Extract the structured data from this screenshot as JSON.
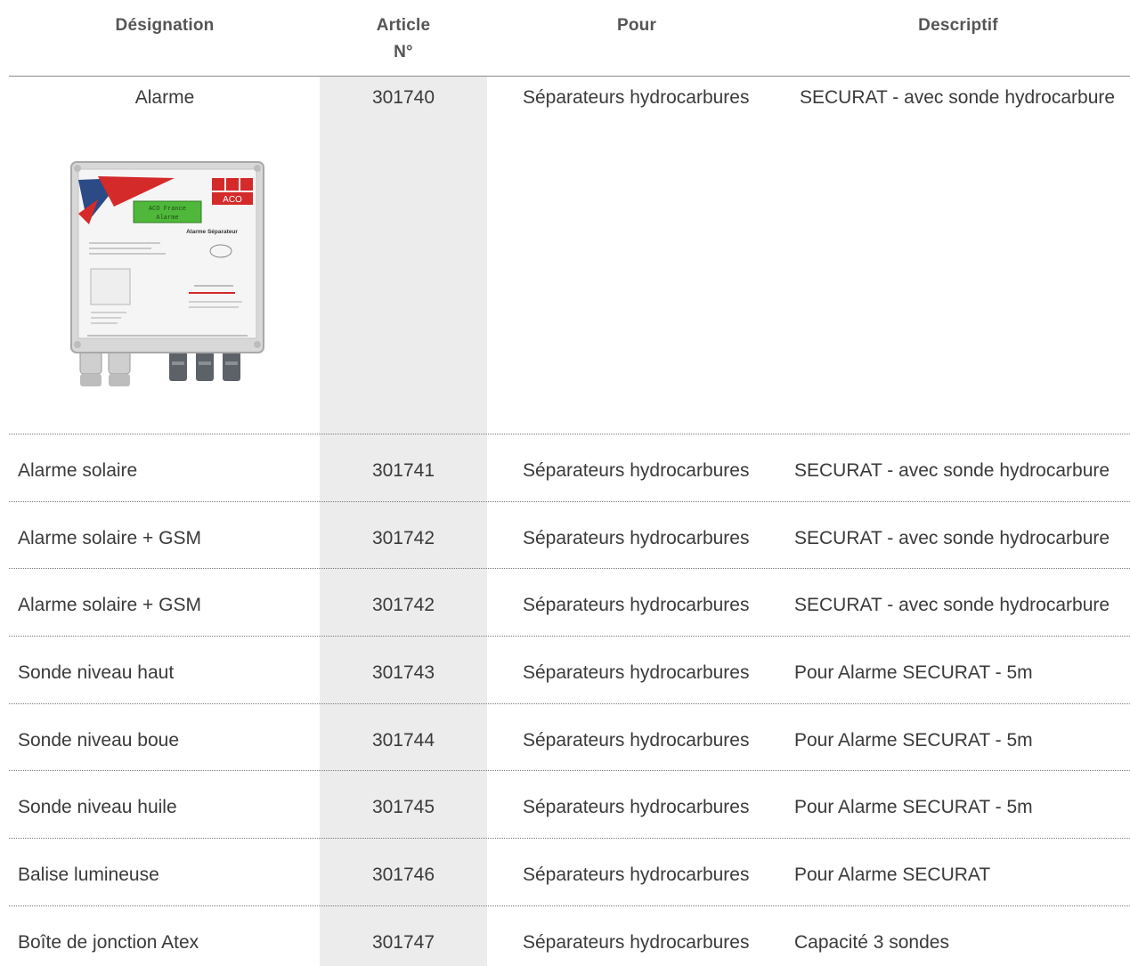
{
  "table": {
    "headers": {
      "designation": "Désignation",
      "article_line1": "Article",
      "article_line2": "N°",
      "pour": "Pour",
      "descriptif": "Descriptif"
    },
    "rows": [
      {
        "designation": "Alarme",
        "article": "301740",
        "pour": "Séparateurs hydrocarbures",
        "descriptif": "SECURAT - avec sonde hydrocarbure"
      },
      {
        "designation": "Alarme solaire",
        "article": "301741",
        "pour": "Séparateurs hydrocarbures",
        "descriptif": "SECURAT - avec sonde hydrocarbure"
      },
      {
        "designation": "Alarme solaire + GSM",
        "article": "301742",
        "pour": "Séparateurs hydrocarbures",
        "descriptif": "SECURAT - avec sonde hydrocarbure"
      },
      {
        "designation": "Alarme solaire + GSM",
        "article": "301742",
        "pour": "Séparateurs hydrocarbures",
        "descriptif": "SECURAT - avec sonde hydrocarbure"
      },
      {
        "designation": "Sonde niveau haut",
        "article": "301743",
        "pour": "Séparateurs hydrocarbures",
        "descriptif": "Pour Alarme SECURAT - 5m"
      },
      {
        "designation": "Sonde niveau boue",
        "article": "301744",
        "pour": "Séparateurs hydrocarbures",
        "descriptif": "Pour Alarme SECURAT - 5m"
      },
      {
        "designation": "Sonde niveau huile",
        "article": "301745",
        "pour": "Séparateurs hydrocarbures",
        "descriptif": "Pour Alarme SECURAT - 5m"
      },
      {
        "designation": "Balise lumineuse",
        "article": "301746",
        "pour": "Séparateurs hydrocarbures",
        "descriptif": "Pour Alarme SECURAT"
      },
      {
        "designation": "Boîte de jonction Atex",
        "article": "301747",
        "pour": "Séparateurs hydrocarbures",
        "descriptif": "Capacité 3 sondes"
      }
    ]
  },
  "product_image": {
    "icon": "alarm-unit-image",
    "brand_text": "ACO",
    "display_text": [
      "ACO France",
      "Alarme"
    ],
    "panel_title": "Alarme Séparateur",
    "colors": {
      "red": "#d42a2a",
      "blue": "#2c4a86",
      "lcd": "#4fb83a"
    }
  }
}
